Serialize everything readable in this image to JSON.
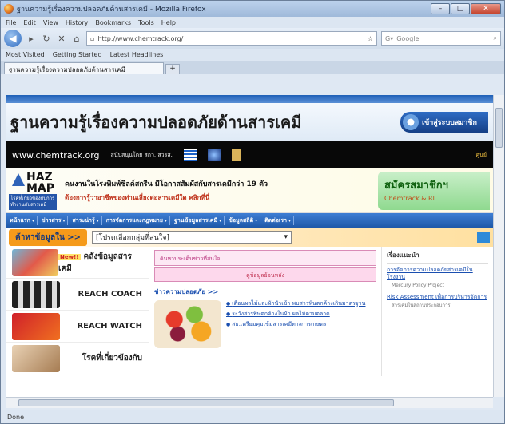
{
  "window": {
    "title": "ฐานความรู้เรื่องความปลอดภัยด้านสารเคมี - Mozilla Firefox",
    "controls": [
      "–",
      "□",
      "✕"
    ]
  },
  "menu": [
    "File",
    "Edit",
    "View",
    "History",
    "Bookmarks",
    "Tools",
    "Help"
  ],
  "nav": {
    "url": "http://www.chemtrack.org/",
    "search_placeholder": "Google",
    "back_glyph": "◀"
  },
  "bookmarks": [
    "Most Visited",
    "Getting Started",
    "Latest Headlines"
  ],
  "tab": {
    "label": "ฐานความรู้เรื่องความปลอดภัยด้านสารเคมี",
    "new_tab": "+"
  },
  "page": {
    "hero_title": "ฐานความรู้เรื่องความปลอดภัยด้านสารเคมี",
    "member_label": "เข้าสู่ระบบสมาชิก",
    "site": "www.chemtrack.org",
    "support": "สนับสนุนโดย สกว. สวรส.",
    "blackbar_right": "ศูนย์",
    "haz": "HAZ",
    "map": "MAP",
    "hazmap_caption": "โรคที่เกี่ยวข้องกับการทำงานกับสารเคมี",
    "banner_line1": "คนงานในโรงพิมพ์ซิลค์สกรีน มีโอกาสสัมผัสกับสารเคมีกว่า 19 ตัว",
    "banner_line2": "ต้องการรู้ว่าอาชีพของท่านเสี่ยงต่อสารเคมีใด คลิกที่นี่",
    "signup_title": "สมัครสมาชิกฯ",
    "signup_sub": "Chemtrack & Rl",
    "navitems": [
      "หน้าแรก",
      "ข่าวสาร",
      "สาระน่ารู้",
      "การจัดการและกฎหมาย",
      "ฐานข้อมูลสารเคมี",
      "ข้อมูลสถิติ",
      "ติดต่อเรา"
    ],
    "select_label": "ค้าหาข้อมูลใน >>",
    "select_value": "[โปรดเลือกกลุ่มที่สนใจ]",
    "left_items": [
      {
        "text": "คลังข้อมูลสารเคมี",
        "badge": "New!!"
      },
      {
        "text": "REACH COACH",
        "badge": ""
      },
      {
        "text": "REACH WATCH",
        "badge": ""
      },
      {
        "text": "โรคที่เกี่ยวข้องกับ",
        "badge": ""
      }
    ],
    "pink_box": "ค้นหาประเด็นข่าวที่สนใจ",
    "pink_button": "ดูข้อมูลย้อนหลัง",
    "news_head": "ข่าวความปลอดภัย >>",
    "news": [
      "เตือนผลไม้และผักนำเข้า พบสารพิษตกค้างเกินมาตรฐาน",
      "ระวังสารพิษตกค้างในผัก ผลไม้ตามตลาด",
      "สธ.เตรียมคุมเข้มสารเคมีทางการเกษตร"
    ],
    "right_head": "เรื่องแนะนำ",
    "right_items": [
      {
        "title": "การจัดการความปลอดภัยสารเคมีในโรงงาน",
        "desc": "Mercury Policy Project"
      },
      {
        "title": "Risk Assessment เพื่อการบริหารจัดการ",
        "desc": "สารเคมีในสถานประกอบการ"
      }
    ]
  },
  "status": "Done"
}
